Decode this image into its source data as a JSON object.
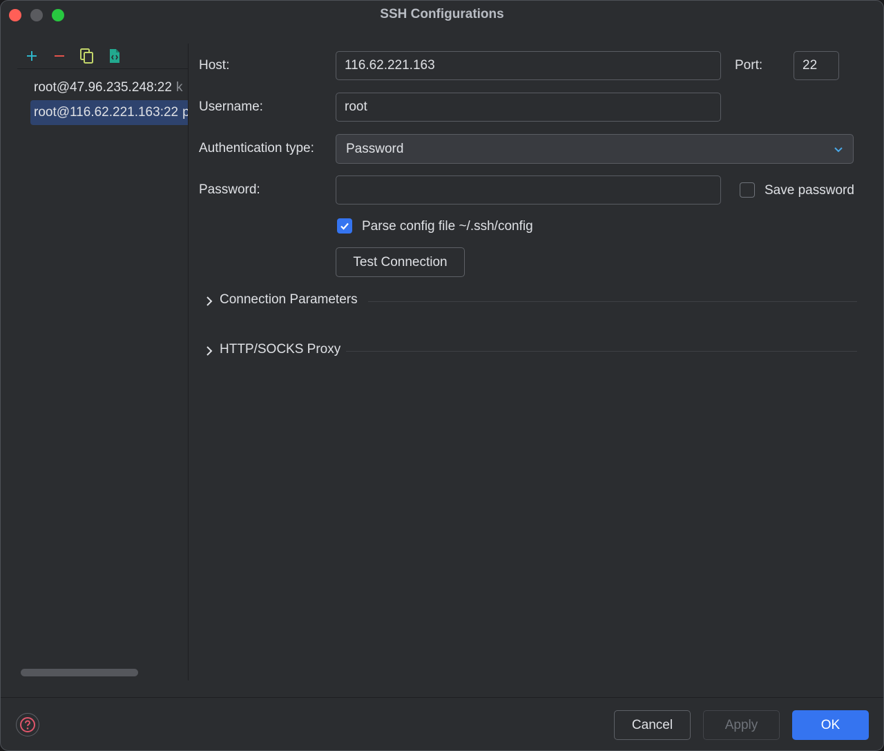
{
  "window": {
    "title": "SSH Configurations"
  },
  "toolbar": {
    "icons": [
      "plus-icon",
      "minus-icon",
      "copy-icon",
      "file-code-icon"
    ],
    "colors": {
      "plus": "#2fb5c9",
      "minus": "#e5534b",
      "copy": "#c3d66a",
      "file": "#22a98f"
    }
  },
  "sidebar": {
    "items": [
      {
        "label": "root@47.96.235.248:22",
        "suffix": "k",
        "selected": false
      },
      {
        "label": "root@116.62.221.163:22",
        "suffix": "p",
        "selected": true
      }
    ]
  },
  "form": {
    "host_label": "Host:",
    "host_value": "116.62.221.163",
    "port_label": "Port:",
    "port_value": "22",
    "username_label": "Username:",
    "username_value": "root",
    "auth_label": "Authentication type:",
    "auth_value": "Password",
    "password_label": "Password:",
    "password_value": "",
    "save_password_label": "Save password",
    "save_password_checked": false,
    "parse_config_label": "Parse config file ~/.ssh/config",
    "parse_config_checked": true,
    "test_connection_label": "Test Connection"
  },
  "sections": {
    "connection_parameters": "Connection Parameters",
    "proxy": "HTTP/SOCKS Proxy"
  },
  "footer": {
    "cancel_label": "Cancel",
    "apply_label": "Apply",
    "ok_label": "OK"
  },
  "colors": {
    "accent": "#3574f0",
    "help_icon": "#e0566b"
  }
}
